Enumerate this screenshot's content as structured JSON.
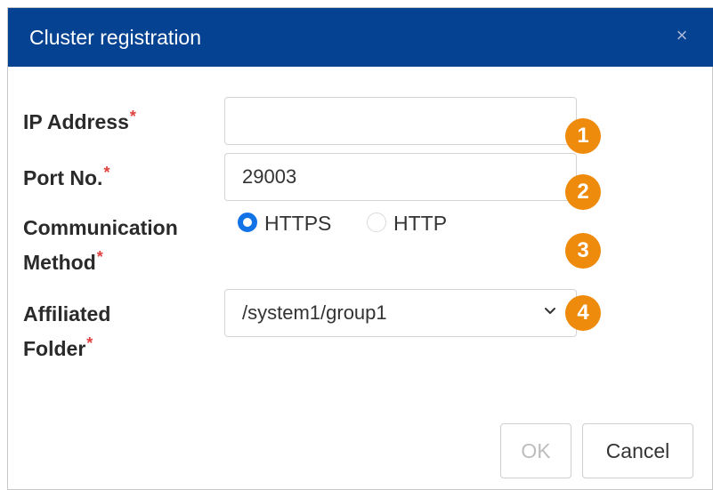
{
  "dialog": {
    "title": "Cluster registration",
    "close_symbol": "×"
  },
  "form": {
    "required_marker": "*",
    "ip_address": {
      "label": "IP Address",
      "value": ""
    },
    "port": {
      "label": "Port No.",
      "value": "29003"
    },
    "method": {
      "label_line1": "Communication",
      "label_line2": "Method",
      "options": [
        {
          "label": "HTTPS",
          "checked": true
        },
        {
          "label": "HTTP",
          "checked": false
        }
      ]
    },
    "folder": {
      "label_line1": "Affiliated",
      "label_line2": "Folder",
      "selected": "/system1/group1"
    }
  },
  "badges": [
    "1",
    "2",
    "3",
    "4"
  ],
  "buttons": {
    "ok": "OK",
    "cancel": "Cancel"
  },
  "colors": {
    "title_bar": "#054292",
    "badge": "#ee8a0c",
    "radio_checked": "#1273e6",
    "required": "#e0413e"
  },
  "icons": {
    "close": "close-icon",
    "dropdown": "chevron-down-icon"
  }
}
